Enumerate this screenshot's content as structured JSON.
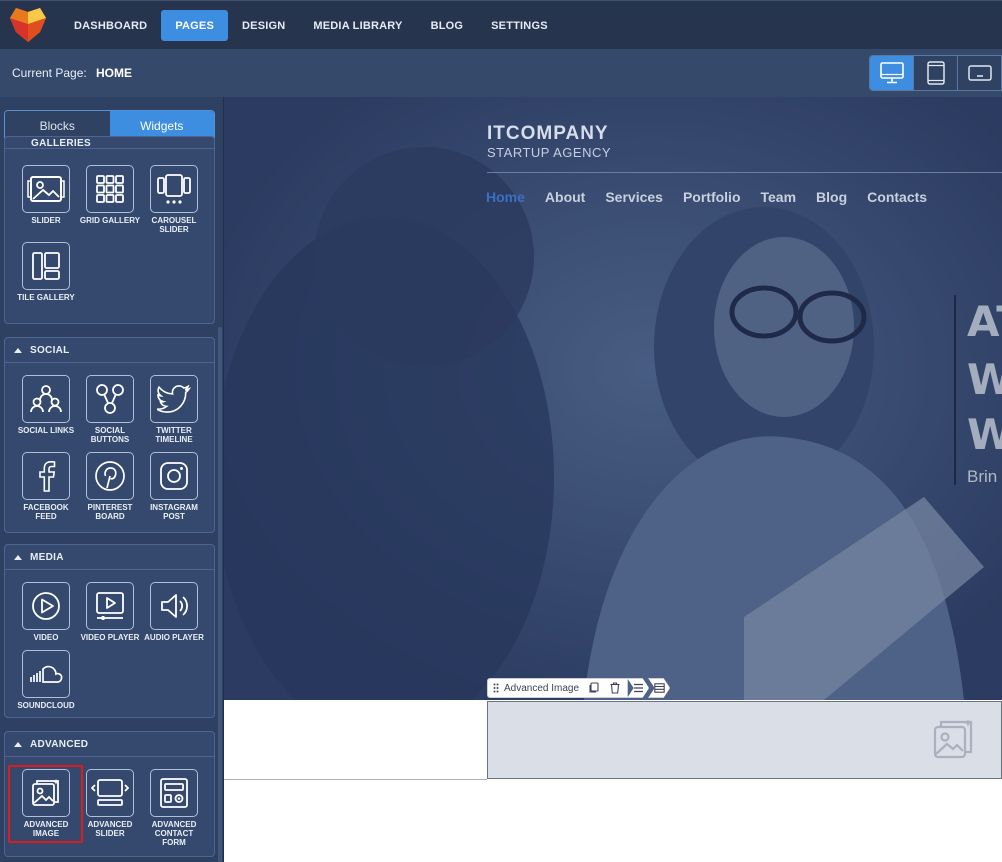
{
  "nav": {
    "items": [
      "DASHBOARD",
      "PAGES",
      "DESIGN",
      "MEDIA LIBRARY",
      "BLOG",
      "SETTINGS"
    ],
    "active": "PAGES"
  },
  "pagebar": {
    "label": "Current Page:",
    "value": "HOME",
    "device_icons": [
      "desktop-icon",
      "tablet-icon",
      "mobile-landscape-icon"
    ]
  },
  "sidebar": {
    "tabs": [
      "Blocks",
      "Widgets"
    ],
    "active_tab": "Widgets",
    "galleries": {
      "title": "GALLERIES",
      "items": [
        "SLIDER",
        "GRID GALLERY",
        "CAROUSEL\nSLIDER",
        "TILE GALLERY"
      ]
    },
    "social": {
      "title": "SOCIAL",
      "items": [
        "SOCIAL LINKS",
        "SOCIAL\nBUTTONS",
        "TWITTER\nTIMELINE",
        "FACEBOOK\nFEED",
        "PINTEREST\nBOARD",
        "INSTAGRAM\nPOST"
      ]
    },
    "media": {
      "title": "MEDIA",
      "items": [
        "VIDEO",
        "VIDEO PLAYER",
        "AUDIO PLAYER",
        "SOUNDCLOUD"
      ]
    },
    "advanced": {
      "title": "ADVANCED",
      "items": [
        "ADVANCED\nIMAGE",
        "ADVANCED\nSLIDER",
        "ADVANCED\nCONTACT\nFORM"
      ]
    }
  },
  "site": {
    "brand": "ITCOMPANY",
    "tagline": "STARTUP AGENCY",
    "nav": [
      "Home",
      "About",
      "Services",
      "Portfolio",
      "Team",
      "Blog",
      "Contacts"
    ],
    "active_nav": "Home",
    "hero_lines": [
      "AT",
      "W",
      "W"
    ],
    "hero_sub": "Brin"
  },
  "widget_toolbar": {
    "label": "Advanced Image"
  },
  "colors": {
    "accent": "#3d8de0",
    "sidebar": "#2e4163",
    "highlight": "#e01b1b"
  }
}
